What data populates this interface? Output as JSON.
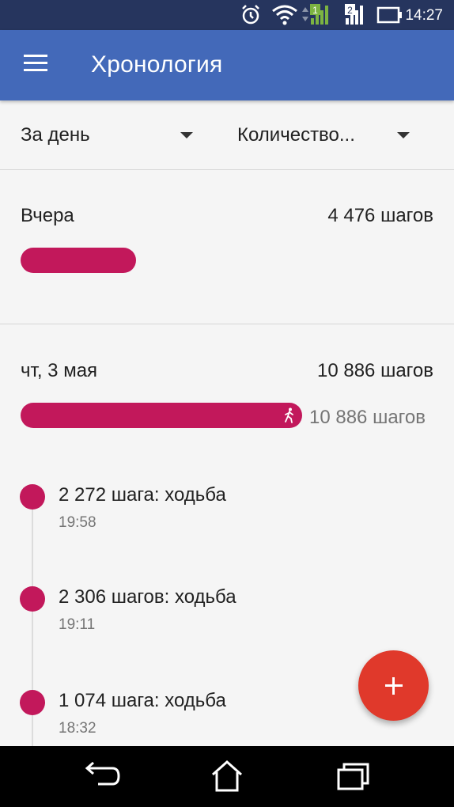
{
  "status_bar": {
    "time": "14:27",
    "icons": [
      "alarm-icon",
      "wifi-icon",
      "signal-sim1-icon",
      "signal-sim2-icon",
      "battery-icon"
    ],
    "sim1_badge": "1",
    "sim2_badge": "2"
  },
  "app_bar": {
    "title": "Хронология",
    "color": "#4369b9"
  },
  "filters": {
    "period": "За день",
    "metric": "Количество..."
  },
  "days": [
    {
      "label": "Вчера",
      "steps": "4 476 шагов",
      "bar_fraction": 0.411
    },
    {
      "label": "чт, 3 мая",
      "steps": "10 886 шагов",
      "bar_fraction": 1.0,
      "bar_value": "10 886 шагов",
      "bar_icon": "walking-icon"
    }
  ],
  "activities": [
    {
      "title": "2 272 шага: ходьба",
      "time": "19:58"
    },
    {
      "title": "2 306 шагов: ходьба",
      "time": "19:11"
    },
    {
      "title": "1 074 шага: ходьба",
      "time": "18:32"
    }
  ],
  "fab": {
    "icon": "plus-icon",
    "color": "#e0392b"
  },
  "accent_color": "#c2185b",
  "nav_bar": [
    "back-icon",
    "home-icon",
    "recents-icon"
  ]
}
